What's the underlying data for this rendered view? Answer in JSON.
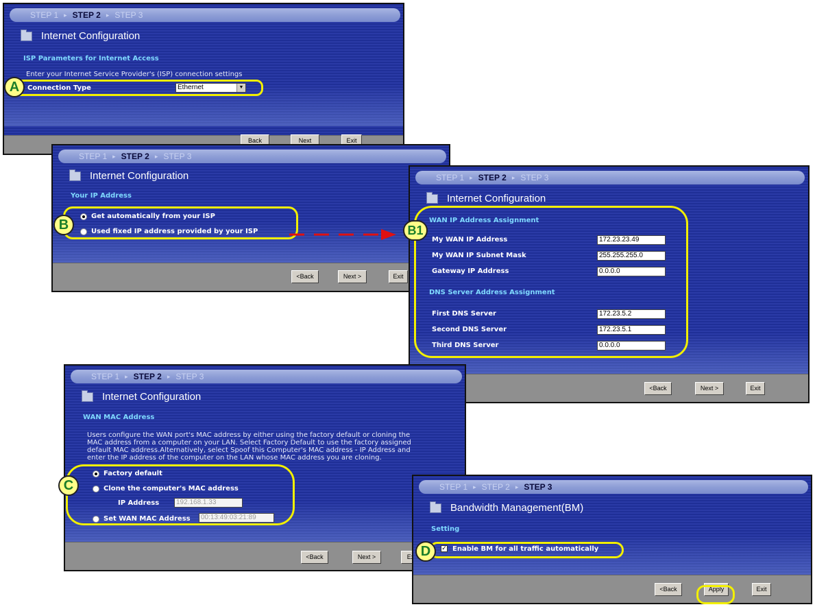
{
  "steps": {
    "s1": "STEP 1",
    "s2": "STEP 2",
    "s3": "STEP 3"
  },
  "internet_title": "Internet Configuration",
  "bm_title": "Bandwidth Management(BM)",
  "buttons": {
    "back": "<Back",
    "next": "Next >",
    "exit": "Exit",
    "apply": "Apply",
    "back_cut": "Back",
    "next_cut": "Next",
    "exit_cut": "Exit",
    "exit_partial": "Ex"
  },
  "panel_a": {
    "section": "ISP Parameters for Internet Access",
    "intro": "Enter your Internet Service Provider's (ISP) connection settings",
    "conn_label": "Connection Type",
    "conn_value": "Ethernet"
  },
  "panel_b": {
    "section": "Your IP Address",
    "opt_auto": "Get automatically from your ISP",
    "opt_fixed": "Used fixed IP address provided by your ISP"
  },
  "panel_b1": {
    "section_wan": "WAN IP Address Assignment",
    "wan_ip_label": "My WAN IP Address",
    "wan_ip": "172.23.23.49",
    "wan_mask_label": "My WAN IP Subnet Mask",
    "wan_mask": "255.255.255.0",
    "gw_label": "Gateway IP Address",
    "gw": "0.0.0.0",
    "section_dns": "DNS Server Address Assignment",
    "dns1_label": "First DNS Server",
    "dns1": "172.23.5.2",
    "dns2_label": "Second DNS Server",
    "dns2": "172.23.5.1",
    "dns3_label": "Third DNS Server",
    "dns3": "0.0.0.0"
  },
  "panel_c": {
    "section": "WAN MAC Address",
    "desc1": "Users configure the WAN port's MAC address by either using the factory default or cloning the",
    "desc2": "MAC address from a computer on your LAN. Select Factory Default to use the factory assigned",
    "desc3": "default MAC address.Alternatively, select Spoof this Computer's MAC address - IP Address and",
    "desc4": "enter the IP address of the computer on the LAN whose MAC address you are cloning.",
    "opt_factory": "Factory default",
    "opt_clone": "Clone the computer's MAC address",
    "ip_label": "IP Address",
    "ip_value": "192.168.1.33",
    "opt_set": "Set WAN MAC Address",
    "mac_value": "00:13:49:03:21:89"
  },
  "panel_d": {
    "section": "Setting",
    "check_label": "Enable BM for all traffic automatically"
  },
  "markers": {
    "a": "A",
    "b": "B",
    "b1": "B1",
    "c": "C",
    "d": "D"
  },
  "colors": {
    "panel_bg": "#1f2f97",
    "section": "#7fd9ff",
    "highlight": "#f2ef00",
    "marker_fill": "#fffd88",
    "marker_text": "#1b7d2a",
    "arrow": "#e01010"
  }
}
